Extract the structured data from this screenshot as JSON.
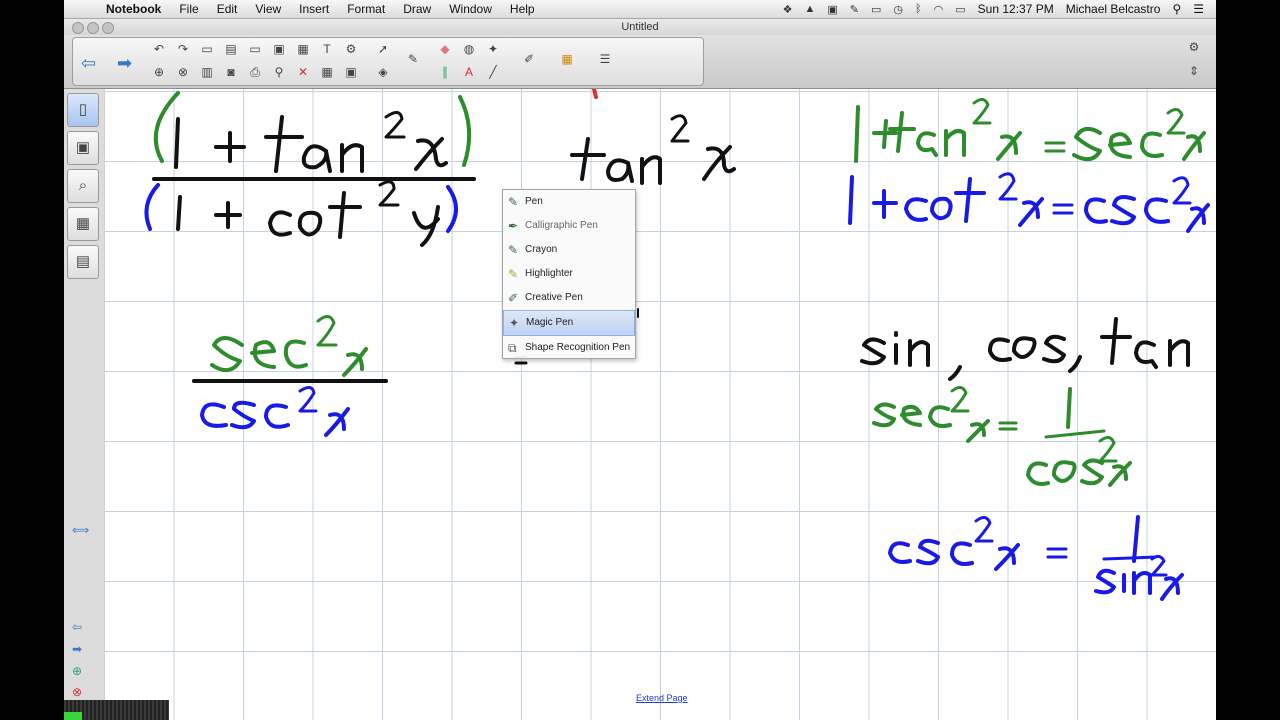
{
  "menubar": {
    "app_name": "Notebook",
    "menus": [
      "File",
      "Edit",
      "View",
      "Insert",
      "Format",
      "Draw",
      "Window",
      "Help"
    ],
    "clock": "Sun 12:37 PM",
    "user": "Michael Belcastro"
  },
  "window": {
    "title": "Untitled"
  },
  "pen_menu": {
    "items": [
      "Pen",
      "Calligraphic Pen",
      "Crayon",
      "Highlighter",
      "Creative Pen",
      "Magic Pen",
      "Shape Recognition Pen"
    ],
    "selected": "Magic Pen"
  },
  "canvas": {
    "extend_label": "Extend Page",
    "ink_colors": {
      "black": "#111111",
      "green": "#2e8b2e",
      "blue": "#1a1ae6",
      "red": "#e03030"
    }
  }
}
